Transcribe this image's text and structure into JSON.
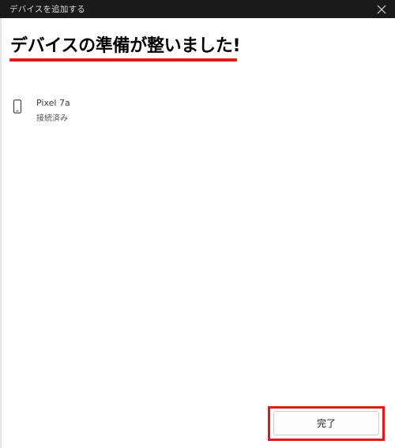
{
  "window": {
    "title": "デバイスを追加する",
    "close_icon": "close-icon"
  },
  "main": {
    "heading": "デバイスの準備が整いました!",
    "accent_color": "#e01818"
  },
  "device": {
    "icon": "phone-icon",
    "name": "Pixel 7a",
    "status": "接続済み"
  },
  "footer": {
    "done_label": "完了"
  }
}
